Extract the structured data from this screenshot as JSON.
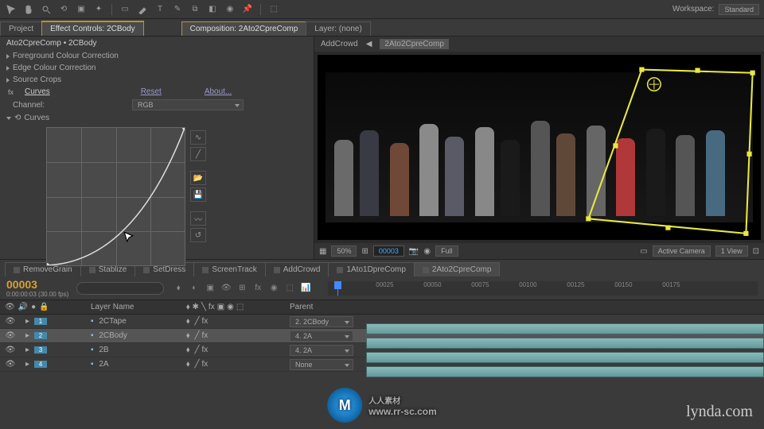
{
  "workspace": {
    "label": "Workspace:",
    "value": "Standard"
  },
  "panels": {
    "project": "Project",
    "effect_controls": "Effect Controls: 2CBody",
    "composition": "Composition: 2Ato2CpreComp",
    "layer": "Layer: (none)"
  },
  "breadcrumb": "Ato2CpreComp • 2CBody",
  "effects": {
    "fg_cc": "Foreground Colour Correction",
    "edge_cc": "Edge Colour Correction",
    "src_crops": "Source Crops",
    "curves": "Curves",
    "reset": "Reset",
    "about": "About...",
    "channel_label": "Channel:",
    "channel_value": "RGB",
    "curves_sub": "Curves"
  },
  "mini_nav": {
    "a": "AddCrowd",
    "b": "2Ato2CpreComp"
  },
  "viewer": {
    "zoom": "50%",
    "frame": "00003",
    "quality": "Full",
    "camera": "Active Camera",
    "views": "1 View"
  },
  "bottom_tabs": [
    "RemoveGrain",
    "Stablize",
    "SetDress",
    "ScreenTrack",
    "AddCrowd",
    "1Ato1DpreComp",
    "2Ato2CpreComp"
  ],
  "timeline": {
    "timecode": "00003",
    "timecode_sub": "0:00:00:03 (30.00 fps)",
    "search_ph": "",
    "col_layer": "Layer Name",
    "col_parent": "Parent",
    "ruler": [
      "00025",
      "00050",
      "00075",
      "00100",
      "00125",
      "00150",
      "00175"
    ],
    "layers": [
      {
        "n": "1",
        "name": "2CTape",
        "parent": "2. 2CBody",
        "sel": false
      },
      {
        "n": "2",
        "name": "2CBody",
        "parent": "4. 2A",
        "sel": true
      },
      {
        "n": "3",
        "name": "2B",
        "parent": "4. 2A",
        "sel": false
      },
      {
        "n": "4",
        "name": "2A",
        "parent": "None",
        "sel": false
      }
    ]
  },
  "watermark": {
    "logo": "M",
    "text": "人人素材",
    "url": "www.rr-sc.com"
  },
  "lynda": "lynda.com"
}
